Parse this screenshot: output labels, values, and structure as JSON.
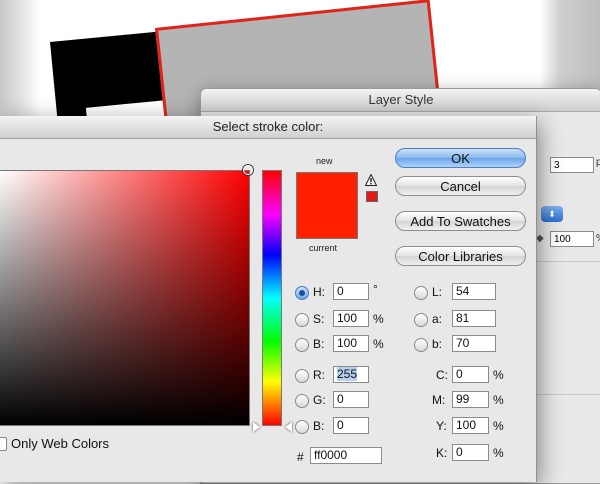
{
  "layer_style": {
    "title": "Layer Style",
    "size_value": "3",
    "size_tail": "p",
    "opacity_value": "100",
    "opacity_tail": "%",
    "blend_arrows": "⬍"
  },
  "picker": {
    "title": "Select stroke color:",
    "new_label": "new",
    "current_label": "current",
    "new_color": "#ff2000",
    "current_color": "#ff2000",
    "only_web_colors": "Only Web Colors",
    "gamut_warning_icon": "warning-triangle-icon",
    "buttons": {
      "ok": "OK",
      "cancel": "Cancel",
      "add_to_swatches": "Add To Swatches",
      "color_libraries": "Color Libraries"
    },
    "hsb": {
      "h": {
        "label": "H:",
        "value": "0",
        "unit": "°",
        "checked": true
      },
      "s": {
        "label": "S:",
        "value": "100",
        "unit": "%"
      },
      "b": {
        "label": "B:",
        "value": "100",
        "unit": "%"
      }
    },
    "rgb": {
      "r": {
        "label": "R:",
        "value": "255"
      },
      "g": {
        "label": "G:",
        "value": "0"
      },
      "b": {
        "label": "B:",
        "value": "0"
      }
    },
    "hex": {
      "label": "#",
      "value": "ff0000"
    },
    "lab": {
      "l": {
        "label": "L:",
        "value": "54"
      },
      "a": {
        "label": "a:",
        "value": "81"
      },
      "b": {
        "label": "b:",
        "value": "70"
      }
    },
    "cmyk": {
      "c": {
        "label": "C:",
        "value": "0",
        "unit": "%"
      },
      "m": {
        "label": "M:",
        "value": "99",
        "unit": "%"
      },
      "y": {
        "label": "Y:",
        "value": "100",
        "unit": "%"
      },
      "k": {
        "label": "K:",
        "value": "0",
        "unit": "%"
      }
    }
  }
}
